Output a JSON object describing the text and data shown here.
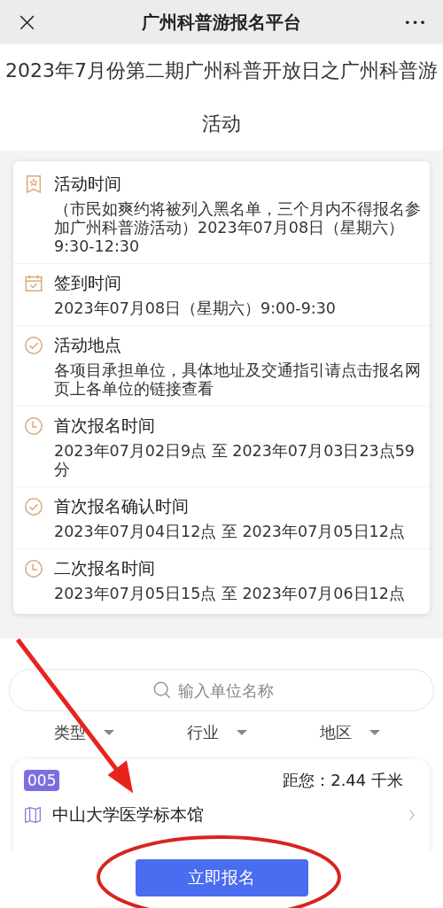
{
  "nav": {
    "close": "×",
    "title": "广州科普游报名平台",
    "more": "•••"
  },
  "heading": "2023年7月份第二期广州科普开放日之广州科普游活动",
  "info_items": [
    {
      "kind": "bookmark",
      "label": "活动时间",
      "detail": "（市民如爽约将被列入黑名单，三个月内不得报名参加广州科普游活动）2023年07月08日（星期六）9:30-12:30"
    },
    {
      "kind": "calendar",
      "label": "签到时间",
      "detail": "2023年07月08日（星期六）9:00-9:30"
    },
    {
      "kind": "check",
      "label": "活动地点",
      "detail": "各项目承担单位，具体地址及交通指引请点击报名网页上各单位的链接查看"
    },
    {
      "kind": "clock",
      "label": "首次报名时间",
      "detail": "2023年07月02日9点 至 2023年07月03日23点59分"
    },
    {
      "kind": "check",
      "label": "首次报名确认时间",
      "detail": "2023年07月04日12点 至 2023年07月05日12点"
    },
    {
      "kind": "clock",
      "label": "二次报名时间",
      "detail": "2023年07月05日15点 至 2023年07月06日12点"
    }
  ],
  "search": {
    "placeholder": "输入单位名称"
  },
  "filters": [
    "类型",
    "行业",
    "地区"
  ],
  "units": [
    {
      "number": "005",
      "distance": "距您：2.44 千米",
      "name": "中山大学医学标本馆"
    }
  ],
  "submit_button": "立即报名"
}
